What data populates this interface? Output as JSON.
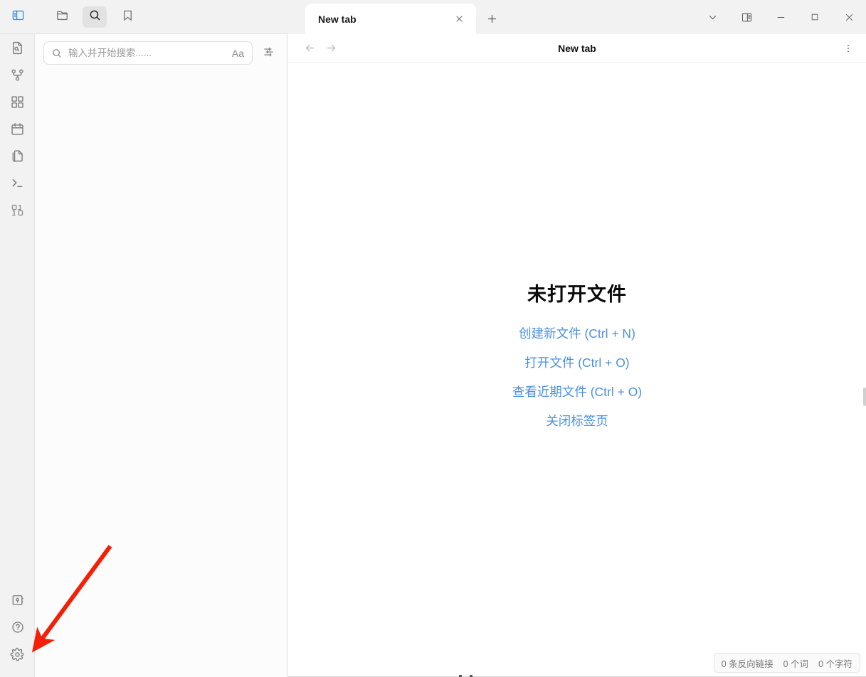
{
  "window": {
    "controls": [
      {
        "name": "chevron-down",
        "label": "∨"
      },
      {
        "name": "split-view",
        "label": ""
      },
      {
        "name": "minimize",
        "label": "−"
      },
      {
        "name": "maximize",
        "label": "□"
      },
      {
        "name": "close",
        "label": "✕"
      }
    ]
  },
  "sidebar_toolbar": {
    "buttons": [
      {
        "name": "toggle-sidebar",
        "icon": "panel-left-icon",
        "state": "highlighted"
      },
      {
        "name": "file-explorer",
        "icon": "folder-icon",
        "state": "normal"
      },
      {
        "name": "search",
        "icon": "search-icon",
        "state": "selected"
      },
      {
        "name": "bookmarks",
        "icon": "bookmark-icon",
        "state": "normal"
      }
    ]
  },
  "rail": {
    "top_items": [
      {
        "name": "document-search",
        "icon": "file-search-icon"
      },
      {
        "name": "graph-view",
        "icon": "graph-icon"
      },
      {
        "name": "plugins",
        "icon": "blocks-icon"
      },
      {
        "name": "calendar",
        "icon": "calendar-icon"
      },
      {
        "name": "templates",
        "icon": "copy-files-icon"
      },
      {
        "name": "terminal",
        "icon": "terminal-icon"
      },
      {
        "name": "code-snippet",
        "icon": "binary-icon"
      }
    ],
    "bottom_items": [
      {
        "name": "vault-switcher",
        "icon": "vault-icon"
      },
      {
        "name": "help",
        "icon": "question-circle-icon"
      },
      {
        "name": "settings",
        "icon": "gear-icon"
      }
    ]
  },
  "search": {
    "placeholder": "输入并开始搜索......",
    "value": "",
    "match_case_label": "Aa",
    "filter_icon": "sliders-icon"
  },
  "tabs": {
    "items": [
      {
        "title": "New tab",
        "active": true,
        "close_label": "✕"
      }
    ],
    "new_tab_label": "+"
  },
  "doc_header": {
    "title": "New tab",
    "back_label": "←",
    "forward_label": "→",
    "more_label": "more-vertical-icon"
  },
  "empty_state": {
    "title": "未打开文件",
    "links": [
      "创建新文件 (Ctrl + N)",
      "打开文件 (Ctrl + O)",
      "查看近期文件 (Ctrl + O)",
      "关闭标签页"
    ]
  },
  "status_bar": {
    "items": [
      "0 条反向链接",
      "0 个词",
      "0 个字符"
    ]
  },
  "annotation": {
    "arrow_color": "#f41f06",
    "points_at": "settings-gear-icon"
  },
  "colors": {
    "rail_bg": "#f2f2f2",
    "sidebar_bg": "#fcfcfc",
    "main_bg": "#ffffff",
    "accent_blue": "#4a90e2",
    "highlight_blue": "#2f8fe8"
  }
}
